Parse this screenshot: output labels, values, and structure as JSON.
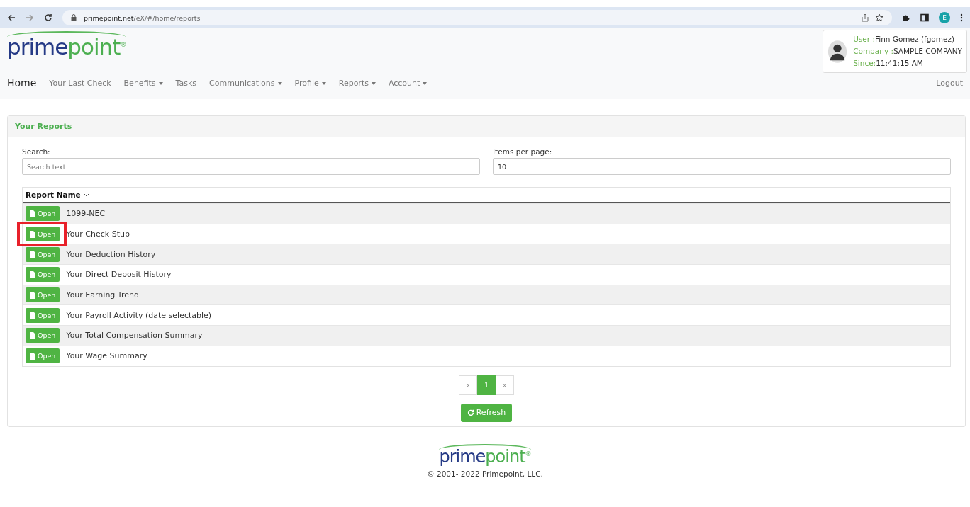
{
  "browser": {
    "url_host": "primepoint.net",
    "url_path": "/eX/#/home/reports",
    "profile_initial": "E"
  },
  "logo": {
    "first": "prime",
    "second": "point",
    "mark": "®"
  },
  "user_card": {
    "fields": [
      {
        "label": "User :",
        "value": "Finn Gomez (fgomez)"
      },
      {
        "label": "Company :",
        "value": "SAMPLE COMPANY"
      },
      {
        "label": "Since:",
        "value": "11:41:15 AM"
      }
    ]
  },
  "nav": {
    "items": [
      {
        "label": "Home",
        "selected": true,
        "dropdown": false
      },
      {
        "label": "Your Last Check",
        "selected": false,
        "dropdown": false
      },
      {
        "label": "Benefits",
        "selected": false,
        "dropdown": true
      },
      {
        "label": "Tasks",
        "selected": false,
        "dropdown": false
      },
      {
        "label": "Communications",
        "selected": false,
        "dropdown": true
      },
      {
        "label": "Profile",
        "selected": false,
        "dropdown": true
      },
      {
        "label": "Reports",
        "selected": false,
        "dropdown": true
      },
      {
        "label": "Account",
        "selected": false,
        "dropdown": true
      }
    ],
    "logout": "Logout"
  },
  "panel": {
    "title": "Your Reports",
    "search": {
      "label": "Search:",
      "placeholder": "Search text"
    },
    "items_per_page": {
      "label": "Items per page:",
      "value": "10"
    },
    "table": {
      "column": "Report Name",
      "rows": [
        {
          "button": "Open",
          "name": "1099-NEC",
          "highlighted": false
        },
        {
          "button": "Open",
          "name": "Your Check Stub",
          "highlighted": true
        },
        {
          "button": "Open",
          "name": "Your Deduction History",
          "highlighted": false
        },
        {
          "button": "Open",
          "name": "Your Direct Deposit History",
          "highlighted": false
        },
        {
          "button": "Open",
          "name": "Your Earning Trend",
          "highlighted": false
        },
        {
          "button": "Open",
          "name": "Your Payroll Activity (date selectable)",
          "highlighted": false
        },
        {
          "button": "Open",
          "name": "Your Total Compensation Summary",
          "highlighted": false
        },
        {
          "button": "Open",
          "name": "Your Wage Summary",
          "highlighted": false
        }
      ]
    },
    "pagination": {
      "prev": "«",
      "pages": [
        {
          "label": "1",
          "selected": true
        }
      ],
      "next": "»"
    },
    "refresh": "Refresh"
  },
  "footer": {
    "logo": {
      "first": "prime",
      "second": "point",
      "mark": "®"
    },
    "copyright": "© 2001- 2022 Primepoint, LLC."
  }
}
